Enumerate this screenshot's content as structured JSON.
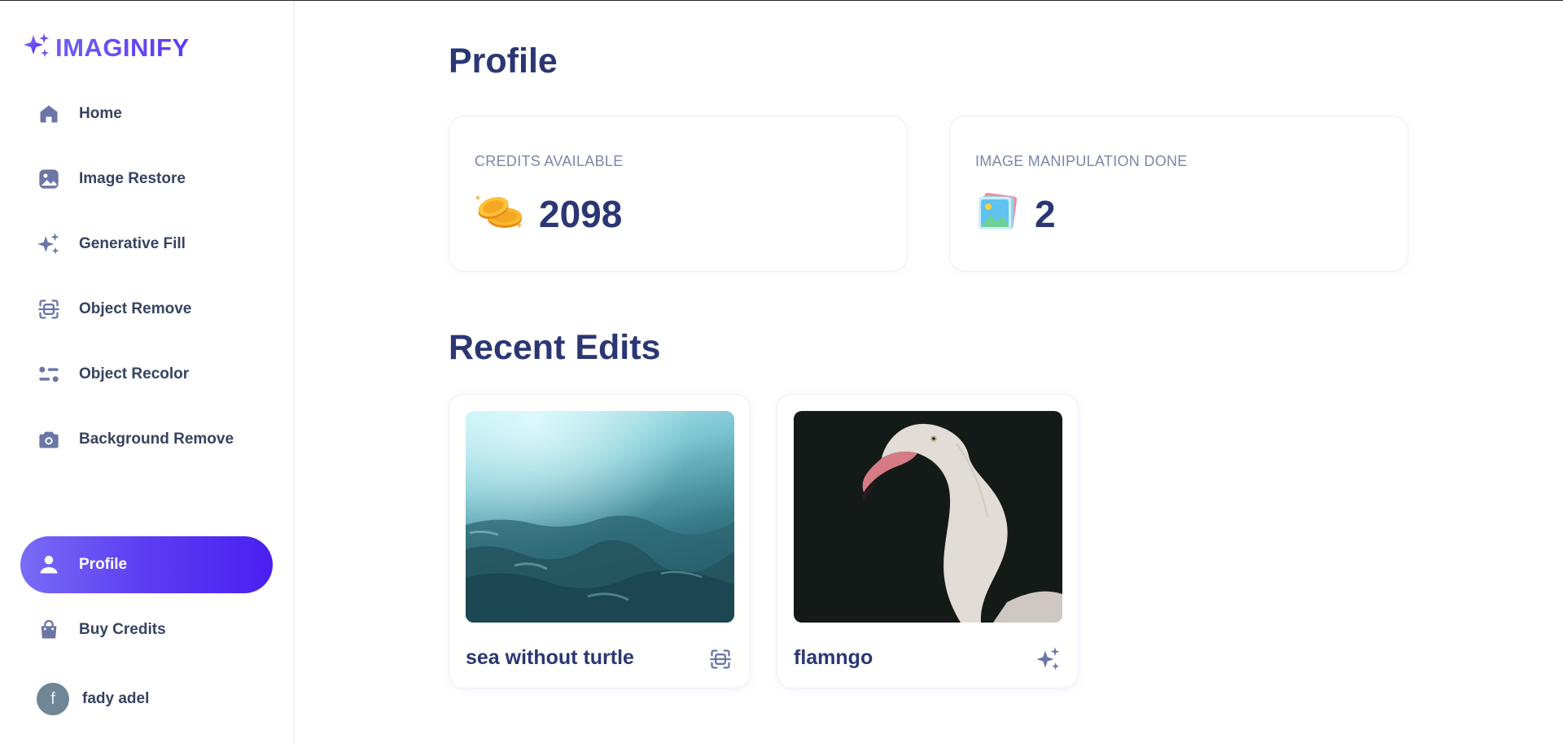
{
  "app": {
    "logo_text": "IMAGINIFY"
  },
  "sidebar": {
    "items": [
      {
        "label": "Home",
        "icon": "home-icon"
      },
      {
        "label": "Image Restore",
        "icon": "image-icon"
      },
      {
        "label": "Generative Fill",
        "icon": "sparkles-icon"
      },
      {
        "label": "Object Remove",
        "icon": "scan-icon"
      },
      {
        "label": "Object Recolor",
        "icon": "filter-icon"
      },
      {
        "label": "Background Remove",
        "icon": "camera-icon"
      }
    ],
    "bottom_items": [
      {
        "label": "Profile",
        "icon": "user-icon",
        "active": true
      },
      {
        "label": "Buy Credits",
        "icon": "bag-icon"
      }
    ],
    "user": {
      "initial": "f",
      "name": "fady adel"
    }
  },
  "main": {
    "title": "Profile",
    "stats": [
      {
        "label": "CREDITS AVAILABLE",
        "value": "2098",
        "icon": "coins-icon"
      },
      {
        "label": "IMAGE MANIPULATION DONE",
        "value": "2",
        "icon": "photo-stack-icon"
      }
    ],
    "recent_title": "Recent Edits",
    "recent_edits": [
      {
        "title": "sea without turtle",
        "icon": "scan-icon"
      },
      {
        "title": "flamngo",
        "icon": "sparkles-icon"
      }
    ]
  },
  "colors": {
    "accent": "#5b3cf3",
    "heading": "#2b3674",
    "muted": "#7c86a8",
    "icon": "#6b76a6"
  }
}
